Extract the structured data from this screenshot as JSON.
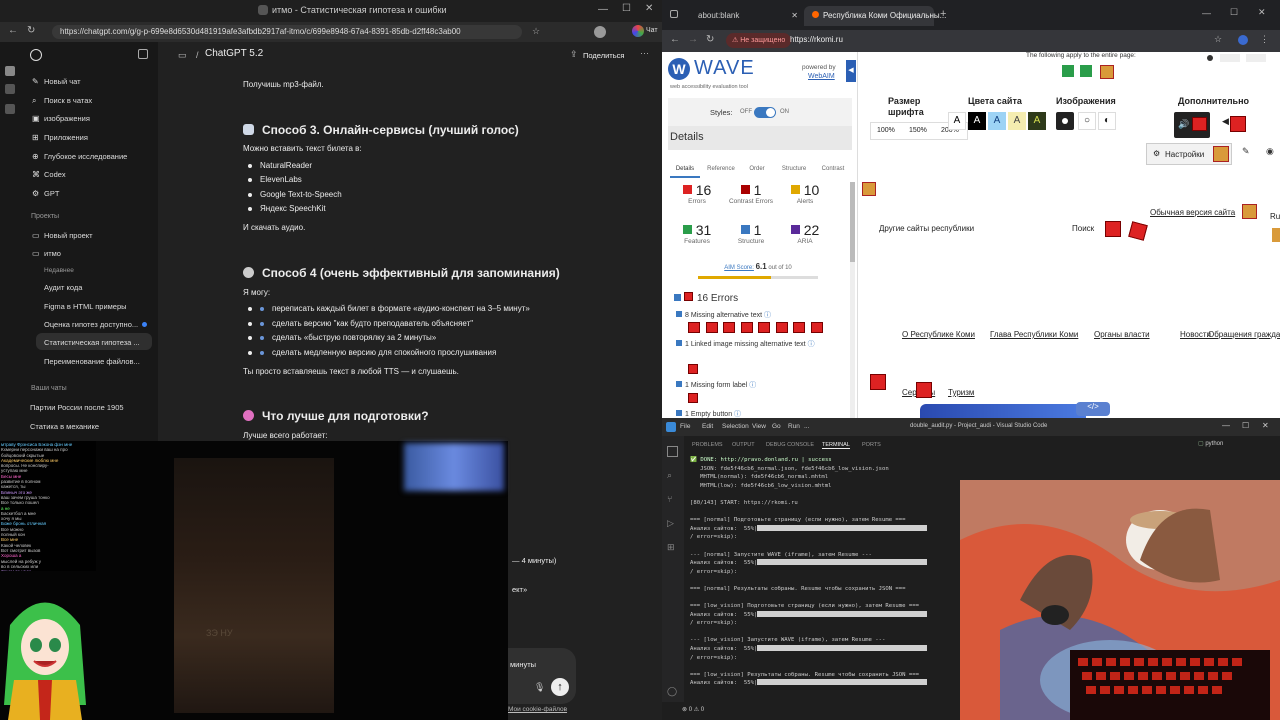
{
  "left_window": {
    "tab_title": "итмо - Статистическая гипотеза и ошибки",
    "url": "https://chatgpt.com/g/g-p-699e8d6530d481919afe3afbdb2917af-itmo/c/699e8948-67a4-8391-85db-d2ff48c3ab00",
    "model_label": "ChatGPT 5.2",
    "share_label": "Поделиться",
    "profile_label": "Чат"
  },
  "sidebar": {
    "items": [
      {
        "label": "Новый чат",
        "icon": "edit-icon"
      },
      {
        "label": "Поиск в чатах",
        "icon": "search-icon"
      },
      {
        "label": "изображения",
        "icon": "image-icon"
      },
      {
        "label": "Приложения",
        "icon": "apps-icon"
      },
      {
        "label": "Глубокое исследование",
        "icon": "research-icon"
      },
      {
        "label": "Codex",
        "icon": "codex-icon"
      },
      {
        "label": "GPT",
        "icon": "gpt-icon"
      }
    ],
    "projects_header": "Проекты",
    "projects": [
      {
        "label": "Новый проект"
      },
      {
        "label": "итмо"
      }
    ],
    "recent_header": "Недавнее",
    "recent": [
      "Аудит кода",
      "Figma в HTML примеры",
      "Оценка гипотез доступно...",
      "Статистическая гипотеза ...",
      "Переименование файлов..."
    ],
    "your_chats_header": "Ваши чаты",
    "chats": [
      "Партии России после 1905",
      "Статика в механике"
    ]
  },
  "chat": {
    "line_mp3": "Получишь mp3-файл.",
    "h_method3": "Способ 3. Онлайн-сервисы (лучший голос)",
    "p_can_paste": "Можно вставить текст билета в:",
    "services": [
      "NaturalReader",
      "ElevenLabs",
      "Google Text-to-Speech",
      "Яндекс SpeechKit"
    ],
    "p_download": "И скачать аудио.",
    "h_method4": "Способ 4 (очень эффективный для запоминания)",
    "p_can": "Я могу:",
    "abilities": [
      "переписать каждый билет в формате «аудио-конспект на 3–5 минут»",
      "сделать версию \"как будто преподаватель объясняет\"",
      "сделать «быструю повторялку за 2 минуты»",
      "сделать медленную версию для спокойного прослушивания"
    ],
    "p_simply": "Ты просто вставляешь текст в любой TTS — и слушаешь.",
    "h_better": "Что лучше для подготовки?",
    "p_best": "Лучше всего работает:",
    "frag_minutes": "— 4 минуты)",
    "frag_ekt": "ект»",
    "frag_min2": "минуты",
    "frag_cookie": "Мои cookie-файлов",
    "cam_caption": "ЗЭ НУ"
  },
  "stream_chat_lines": [
    "мтраву Фрэнсиса Бэкона фэн мне",
    "Кхмерни персонажи ваш на про",
    "бойцовский скрытые",
    "Академические люблю мне",
    "вопросы. Не конспиру-",
    "уступаю мне",
    "Бесы мне",
    "развитие в полном",
    "кажется, ты",
    "Блиныч это же",
    "ваш зачем груша тонко",
    "Все только пошел",
    "а не",
    "Баскетбол а мне",
    "хочу я мы",
    "Боже бронь отличная",
    "Все можно",
    "полный кон",
    "Все мне",
    "Какой человек",
    "Вот смотрит вызов",
    "Хороша а",
    "мыслей на ребуж у",
    "во в сельских или",
    "Зачем то надо",
    "Все финансы в",
    "то неделю в",
    "полностью ты",
    "и",
    "Все взаимно",
    "работу это как",
    "только бесконечные",
    "не",
    "в что",
    "выборы"
  ],
  "right_top": {
    "tabs": [
      "about:blank",
      "Республика Коми Официальны..."
    ],
    "not_secure": "Не защищено",
    "url": "https://rkomi.ru",
    "wave": {
      "title": "WAVE",
      "powered": "powered by",
      "webaim": "WebAIM",
      "subtitle": "web accessibility evaluation tool",
      "styles_label": "Styles:",
      "off": "OFF",
      "on": "ON",
      "details": "Details",
      "nav_tabs": [
        "Details",
        "Reference",
        "Order",
        "Structure",
        "Contrast"
      ],
      "stats": [
        {
          "n": "16",
          "label": "Errors",
          "color": "#d22"
        },
        {
          "n": "1",
          "label": "Contrast Errors",
          "color": "#a00"
        },
        {
          "n": "10",
          "label": "Alerts",
          "color": "#e0a800"
        },
        {
          "n": "31",
          "label": "Features",
          "color": "#2a9d4a"
        },
        {
          "n": "1",
          "label": "Structure",
          "color": "#3a78c0"
        },
        {
          "n": "22",
          "label": "ARIA",
          "color": "#5a2a9a"
        }
      ],
      "aim_label": "AIM Score:",
      "aim_value": "6.1",
      "aim_out_of": "out of 10",
      "aim_fraction": 0.61,
      "errors_header": "16 Errors",
      "error_items": [
        "8 Missing alternative text",
        "1 Linked image missing alternative text",
        "1 Missing form label",
        "1 Empty button"
      ]
    },
    "site": {
      "apply_note": "The following apply to the entire page:",
      "font_size_label": "Размер шрифта",
      "colors_label": "Цвета сайта",
      "images_label": "Изображения",
      "extra_label": "Дополнительно",
      "sizes": [
        "100%",
        "150%",
        "200%"
      ],
      "letter_a": "A",
      "settings": "Настройки",
      "other_sites": "Другие сайты республики",
      "search": "Поиск",
      "normal_version": "Обычная версия сайта",
      "ru_frag": "Ru",
      "nav": [
        "О Республике Коми",
        "Глава Республики Коми",
        "Органы власти",
        "Новости",
        "Обращения гражда"
      ],
      "nav2": [
        "Сервисы",
        "Туризм"
      ]
    }
  },
  "vscode": {
    "title": "double_audit.py - Project_audi - Visual Studio Code",
    "menu": [
      "File",
      "Edit",
      "Selection",
      "View",
      "Go",
      "Run",
      "..."
    ],
    "panel_tabs": [
      "PROBLEMS",
      "OUTPUT",
      "DEBUG CONSOLE",
      "TERMINAL",
      "PORTS"
    ],
    "python_label": "python",
    "status_errors": "0",
    "status_warnings": "0",
    "terminal_lines": [
      {
        "t": "✅ DONE: http://pravo.donland.ru | success"
      },
      {
        "t": "   JSON: fde5f46cb6_normal.json, fde5f46cb6_low_vision.json"
      },
      {
        "t": "   MHTML(normal): fde5f46cb6_normal.mhtml"
      },
      {
        "t": "   MHTML(low): fde5f46cb6_low_vision.mhtml"
      },
      {
        "t": ""
      },
      {
        "t": "[80/143] START: https://rkomi.ru"
      },
      {
        "t": ""
      },
      {
        "t": "=== [normal] Подготовьте страницу (если нужно), затем Resume ==="
      },
      {
        "t": "Анализ сайтов:  55%|",
        "bar": true
      },
      {
        "t": "/ error=skip):"
      },
      {
        "t": ""
      },
      {
        "t": "--- [normal] Запустите WAVE (iframe), затем Resume ---"
      },
      {
        "t": "Анализ сайтов:  55%|",
        "bar": true
      },
      {
        "t": "/ error=skip):"
      },
      {
        "t": ""
      },
      {
        "t": "=== [normal] Результаты собраны. Resume чтобы сохранить JSON ==="
      },
      {
        "t": ""
      },
      {
        "t": "=== [low_vision] Подготовьте страницу (если нужно), затем Resume ==="
      },
      {
        "t": "Анализ сайтов:  55%|",
        "bar": true
      },
      {
        "t": "/ error=skip):"
      },
      {
        "t": ""
      },
      {
        "t": "--- [low_vision] Запустите WAVE (iframe), затем Resume ---"
      },
      {
        "t": "Анализ сайтов:  55%|",
        "bar": true
      },
      {
        "t": "/ error=skip):"
      },
      {
        "t": ""
      },
      {
        "t": "=== [low_vision] Результаты собраны. Resume чтобы сохранить JSON ==="
      },
      {
        "t": "Анализ сайтов:  55%|",
        "bar": true
      }
    ]
  }
}
